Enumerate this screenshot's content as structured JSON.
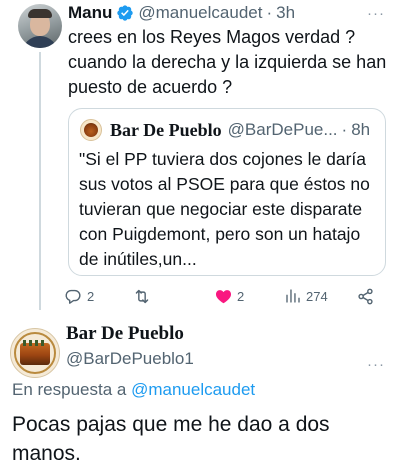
{
  "tweet1": {
    "name": "Manu",
    "handle": "@manuelcaudet",
    "separator": "·",
    "time": "3h",
    "more": "···",
    "text": "crees en los Reyes Magos verdad ? cuando la derecha y la izquierda se han puesto de acuerdo ?",
    "quote": {
      "name": "Bar De Pueblo",
      "handle": "@BarDePue...",
      "separator": "·",
      "time": "8h",
      "text": "\"Si el PP tuviera dos cojones le daría sus votos al PSOE para que éstos no tuvieran que negociar este disparate con Puigdemont, pero son un hatajo de inútiles,un..."
    },
    "actions": {
      "replies": "2",
      "retweets": "",
      "likes": "2",
      "views": "274"
    }
  },
  "tweet2": {
    "name": "Bar De Pueblo",
    "handle": "@BarDePueblo1",
    "more": "···",
    "reply_prefix": "En respuesta a",
    "reply_mention": "@manuelcaudet",
    "text": "Pocas pajas que me he dao a dos manos."
  },
  "colors": {
    "verified": "#1d9bf0",
    "like_heart": "#f91880",
    "muted": "#536471",
    "link": "#1d9bf0"
  },
  "icons": [
    "verified-badge-icon",
    "more-icon",
    "reply-icon",
    "retweet-icon",
    "heart-icon",
    "views-icon",
    "share-icon"
  ]
}
